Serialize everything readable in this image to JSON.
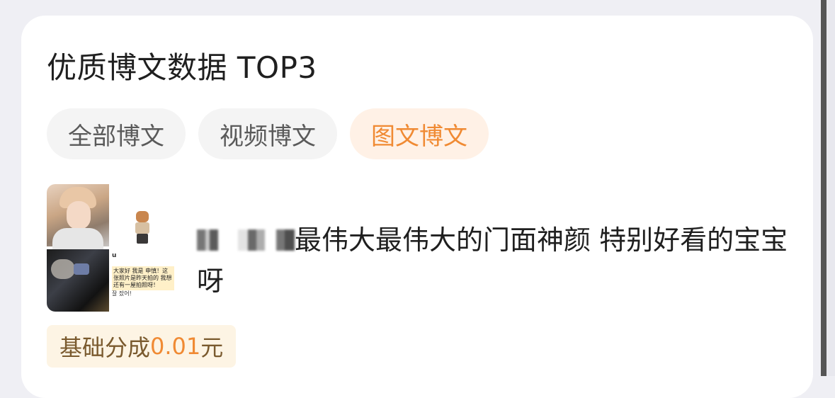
{
  "section_title": "优质博文数据 TOP3",
  "tabs": [
    {
      "label": "全部博文",
      "active": false
    },
    {
      "label": "视频博文",
      "active": false
    },
    {
      "label": "图文博文",
      "active": true
    }
  ],
  "post": {
    "text": "最伟大最伟大的门面神颜 特别好看的宝宝呀",
    "thumbnail": {
      "username": "u",
      "snippet": "大家好 我是 申慎！这张照片是昨天拍的 我想 还有一屋拍照呀！",
      "reaction": "잘 잤어!"
    },
    "earnings": {
      "label": "基础分成",
      "value": "0.01",
      "unit": "元"
    }
  },
  "colors": {
    "accent": "#f08a33",
    "active_tab_bg": "#fff1e6",
    "earnings_bg": "#fdf4e4"
  }
}
